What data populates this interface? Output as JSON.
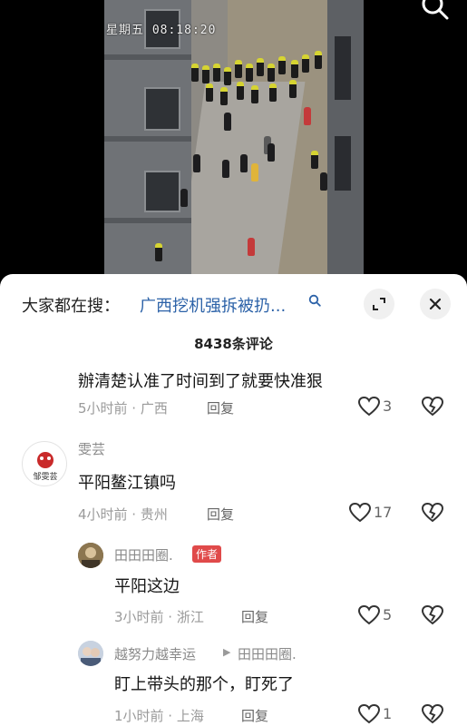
{
  "video": {
    "timestamp": "星期五 08:18:20"
  },
  "icons": {
    "top_search": "search-icon",
    "expand": "expand-icon",
    "close": "close-icon",
    "like": "heart-icon",
    "dislike": "broken-heart-icon"
  },
  "search_bar": {
    "label": "大家都在搜：",
    "term": "广西挖机强拆被扔..."
  },
  "comment_count": "8438条评论",
  "comments": [
    {
      "text": "辦清楚认准了时间到了就要快准狠",
      "time_location": "5小时前 · 广西",
      "reply_label": "回复",
      "likes": "3"
    },
    {
      "username": "雯芸",
      "avatar_text": "邹雯芸",
      "text": "平阳鳌江镇吗",
      "time_location": "4小时前 · 贵州",
      "reply_label": "回复",
      "likes": "17"
    },
    {
      "username": "田田田圈.",
      "badge": "作者",
      "text": "平阳这边",
      "time_location": "3小时前 · 浙江",
      "reply_label": "回复",
      "likes": "5"
    },
    {
      "username": "越努力越幸运",
      "reply_to": "田田田圈.",
      "text": "盯上带头的那个，盯死了",
      "time_location": "1小时前 · 上海",
      "reply_label": "回复",
      "likes": "1"
    }
  ],
  "colors": {
    "link_blue": "#2c62a8",
    "author_badge": "#e04a4a",
    "vest_yellow": "#d6d432"
  }
}
